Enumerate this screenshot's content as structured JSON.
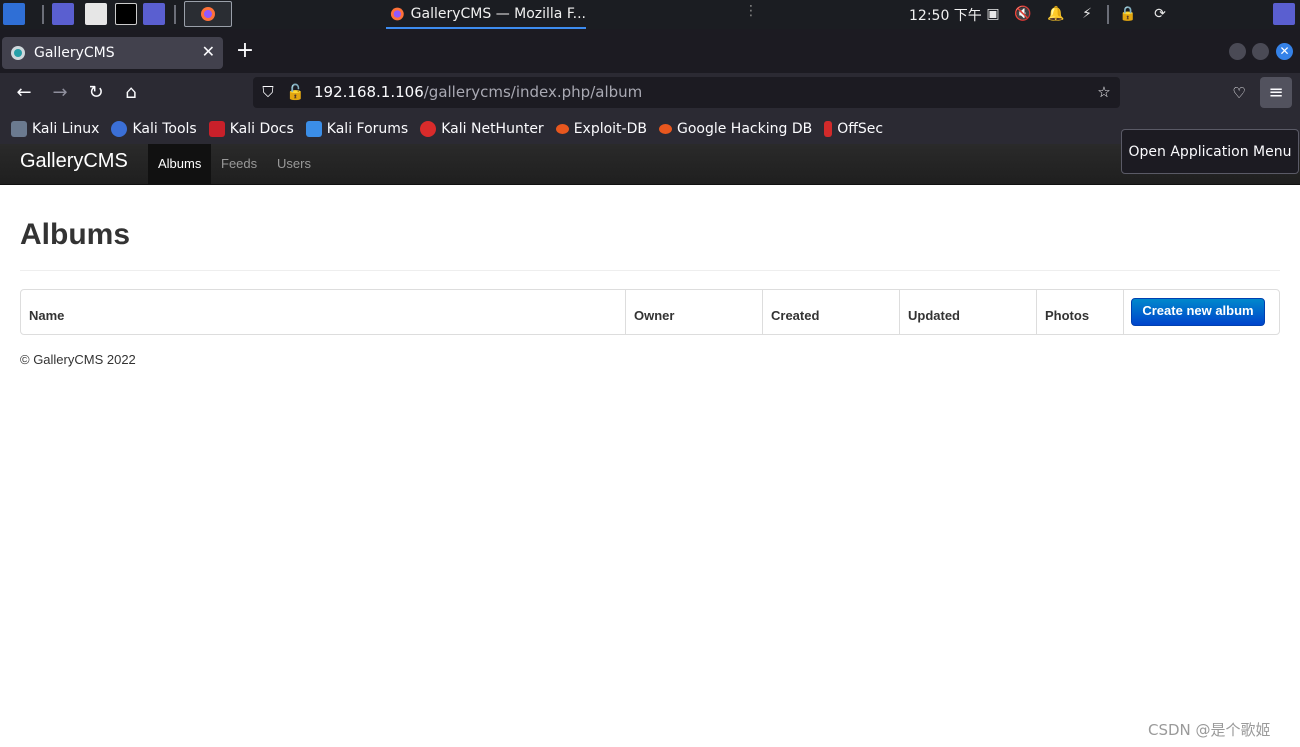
{
  "taskbar": {
    "window_title": "GalleryCMS — Mozilla F...",
    "clock": "12:50 下午"
  },
  "browser": {
    "tab_title": "GalleryCMS",
    "url_host": "192.168.1.106",
    "url_path": "/gallerycms/index.php/album",
    "tooltip": "Open Application Menu",
    "bookmarks": [
      "Kali Linux",
      "Kali Tools",
      "Kali Docs",
      "Kali Forums",
      "Kali NetHunter",
      "Exploit-DB",
      "Google Hacking DB",
      "OffSec"
    ]
  },
  "site": {
    "brand": "GalleryCMS",
    "nav": [
      "Albums",
      "Feeds",
      "Users"
    ],
    "page_title": "Albums",
    "table": {
      "columns": [
        "Name",
        "Owner",
        "Created",
        "Updated",
        "Photos"
      ],
      "create_button": "Create new album"
    },
    "footer": "© GalleryCMS 2022"
  },
  "watermark": "CSDN @是个歌姬",
  "colors": {
    "accent": "#3d8cf0",
    "primary_button": "#0055cc",
    "navbar": "#222222"
  }
}
